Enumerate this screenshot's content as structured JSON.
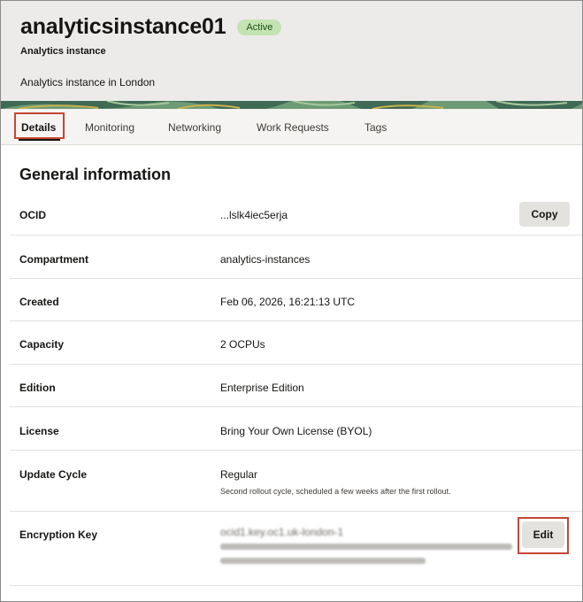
{
  "header": {
    "title": "analyticsinstance01",
    "status_badge": "Active",
    "subtitle": "Analytics instance",
    "description": "Analytics instance in London"
  },
  "tabs": [
    {
      "label": "Details",
      "active": true
    },
    {
      "label": "Monitoring"
    },
    {
      "label": "Networking"
    },
    {
      "label": "Work Requests"
    },
    {
      "label": "Tags"
    }
  ],
  "section": {
    "title": "General information"
  },
  "rows": {
    "ocid": {
      "label": "OCID",
      "value": "...lslk4iec5erja",
      "button": "Copy"
    },
    "compartment": {
      "label": "Compartment",
      "value": "analytics-instances"
    },
    "created": {
      "label": "Created",
      "value": "Feb 06, 2026, 16:21:13 UTC"
    },
    "capacity": {
      "label": "Capacity",
      "value": "2 OCPUs"
    },
    "edition": {
      "label": "Edition",
      "value": "Enterprise Edition"
    },
    "license": {
      "label": "License",
      "value": "Bring Your Own License (BYOL)"
    },
    "update_cycle": {
      "label": "Update Cycle",
      "value": "Regular",
      "note": "Second rollout cycle, scheduled a few weeks after the first rollout."
    },
    "encryption_key": {
      "label": "Encryption Key",
      "value": "ocid1.key.oc1.uk-london-1",
      "button": "Edit"
    }
  },
  "colors": {
    "accent_highlight": "#c74634",
    "active_badge_bg": "#c4e3b2",
    "header_bg": "#ecebea"
  }
}
